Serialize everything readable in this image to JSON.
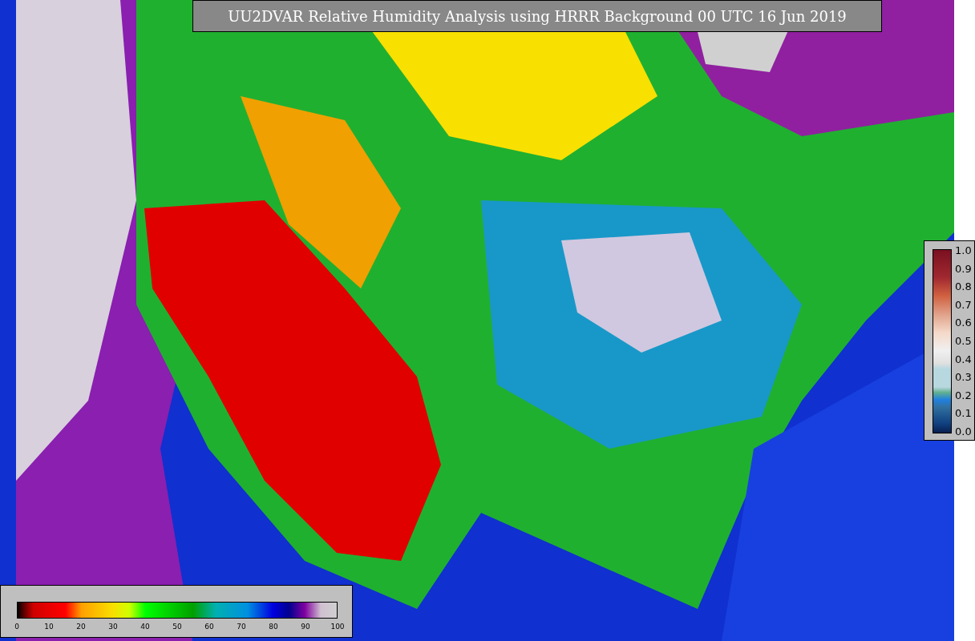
{
  "title": "UU2DVAR Relative Humidity Analysis using HRRR Background 00 UTC 16 Jun 2019",
  "humidity_colorbar": {
    "ticks": [
      "0",
      "10",
      "20",
      "30",
      "40",
      "50",
      "60",
      "70",
      "80",
      "90",
      "100"
    ]
  },
  "observation_colorbar": {
    "ticks": [
      "1.0",
      "0.9",
      "0.8",
      "0.7",
      "0.6",
      "0.5",
      "0.4",
      "0.3",
      "0.2",
      "0.1",
      "0.0"
    ]
  }
}
